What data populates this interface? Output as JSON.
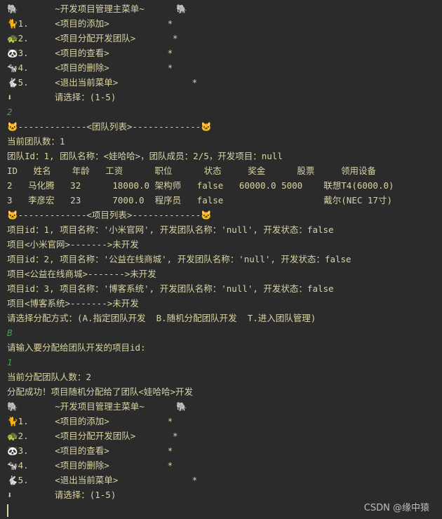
{
  "console": {
    "lines": [
      "🐘       ~开发项目管理主菜单~      🐘",
      "🐈1.     <项目的添加>           *",
      "🐢2.     <项目分配开发团队>       *",
      "🐼3.     <项目的查看>           *",
      "🐄4.     <项目的删除>           *",
      "🐇5.     <退出当前菜单>              *",
      "⬇        请选择：(1-5)",
      "2",
      "🐱-------------<团队列表>-------------🐱",
      "当前团队数：1",
      "团队Id：1, 团队名称：<娃哈哈>，团队成员：2/5，开发项目：null",
      "ID   姓名    年龄   工资      职位      状态     奖金      股票     领用设备",
      "2   马化腾   32      18000.0 架构师   false   60000.0 5000    联想T4(6000.0)",
      "3   李彦宏   23      7000.0  程序员   false                   戴尔(NEC 17寸)",
      "🐱-------------<项目列表>-------------🐱",
      "项目id：1, 项目名称：'小米官网', 开发团队名称：'null', 开发状态：false",
      "项目<小米官网>------->未开发",
      "项目id：2, 项目名称：'公益在线商城', 开发团队名称：'null', 开发状态：false",
      "项目<公益在线商城>------->未开发",
      "项目id：3, 项目名称：'博客系统', 开发团队名称：'null', 开发状态：false",
      "项目<博客系统>------->未开发",
      "请选择分配方式：(A.指定团队开发  B.随机分配团队开发  T.进入团队管理)",
      "B",
      "请输入要分配给团队开发的项目id:",
      "1",
      "当前分配团队人数：2",
      "分配成功！项目随机分配给了团队<娃哈哈>开发",
      "🐘       ~开发项目管理主菜单~      🐘",
      "🐈1.     <项目的添加>           *",
      "🐢2.     <项目分配开发团队>       *",
      "🐼3.     <项目的查看>           *",
      "🐄4.     <项目的删除>           *",
      "🐇5.     <退出当前菜单>              *",
      "⬇        请选择：(1-5)"
    ],
    "input_line_indices": [
      7,
      22,
      24
    ],
    "watermark": "CSDN @缘中猿"
  }
}
